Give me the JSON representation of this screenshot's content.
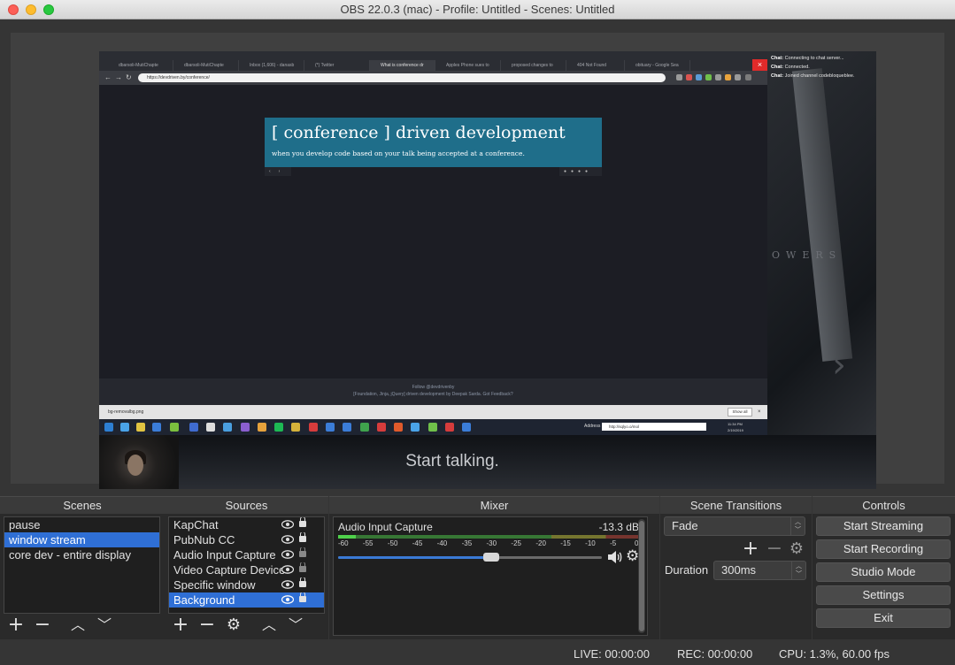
{
  "window": {
    "title": "OBS 22.0.3 (mac) - Profile: Untitled - Scenes: Untitled"
  },
  "preview": {
    "browser": {
      "tabs": [
        {
          "label": "dbarsoli-MutiChapte",
          "active": false
        },
        {
          "label": "dbarsoli-MutiChapte",
          "active": false
        },
        {
          "label": "Inbox (1,606) - danasb",
          "active": false
        },
        {
          "label": "(*) Twitter",
          "active": false
        },
        {
          "label": "What is conference dr",
          "active": true
        },
        {
          "label": "Apples Phone sues to",
          "active": false
        },
        {
          "label": "proposed changes to",
          "active": false
        },
        {
          "label": "404 Not Found",
          "active": false
        },
        {
          "label": "obituary - Google Sea",
          "active": false
        }
      ],
      "url": "https://devdriven.by/conference/",
      "page_title": "[ conference ] driven development",
      "page_subtitle": "when you develop code based on your talk being accepted at a conference.",
      "footer_line1": "Follow @devdrivenby",
      "footer_line2": "[Foundation, Jinja, jQuery] driven development by Deepak Sarda. Got Feedback?",
      "download_file": "bg-removalbg.png",
      "download_show_all": "Show all",
      "taskbar_address_label": "Address",
      "taskbar_address": "http://sqlyo.o/mol",
      "taskbar_clock_time": "11:34 PM",
      "taskbar_clock_date": "2/19/2019"
    },
    "chat": [
      {
        "label": "Chat:",
        "text": "Connecting to chat server..."
      },
      {
        "label": "Chat:",
        "text": "Connected."
      },
      {
        "label": "Chat:",
        "text": "Joined channel codebloqueblee."
      }
    ],
    "photo_text": "OWERS",
    "overlay_text": "Start talking."
  },
  "scenes": {
    "header": "Scenes",
    "items": [
      {
        "label": "pause",
        "selected": false
      },
      {
        "label": "window stream",
        "selected": true
      },
      {
        "label": "core dev - entire display",
        "selected": false
      }
    ]
  },
  "sources": {
    "header": "Sources",
    "items": [
      {
        "label": "KapChat",
        "selected": false
      },
      {
        "label": "PubNub CC",
        "selected": false
      },
      {
        "label": "Audio Input Capture",
        "selected": false
      },
      {
        "label": "Video Capture Device",
        "selected": false
      },
      {
        "label": "Specific window",
        "selected": false
      },
      {
        "label": "Background",
        "selected": true
      }
    ]
  },
  "mixer": {
    "header": "Mixer",
    "channel_name": "Audio Input Capture",
    "level": "-13.3 dB",
    "ticks": [
      "-60",
      "-55",
      "-50",
      "-45",
      "-40",
      "-35",
      "-30",
      "-25",
      "-20",
      "-15",
      "-10",
      "-5",
      "0"
    ],
    "volume_fraction": 0.58
  },
  "transitions": {
    "header": "Scene Transitions",
    "selected": "Fade",
    "duration_label": "Duration",
    "duration_value": "300ms"
  },
  "controls": {
    "header": "Controls",
    "start_streaming": "Start Streaming",
    "start_recording": "Start Recording",
    "studio_mode": "Studio Mode",
    "settings": "Settings",
    "exit": "Exit"
  },
  "status": {
    "live": "LIVE: 00:00:00",
    "rec": "REC: 00:00:00",
    "cpu": "CPU: 1.3%, 60.00 fps"
  }
}
